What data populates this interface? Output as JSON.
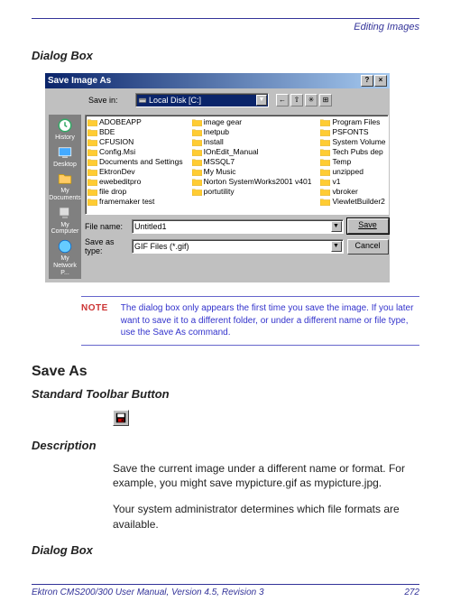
{
  "header": "Editing Images",
  "sections": {
    "dialog_box_1": "Dialog Box",
    "save_as": "Save As",
    "standard_toolbar": "Standard Toolbar Button",
    "description_label": "Description",
    "dialog_box_2": "Dialog Box"
  },
  "dialog": {
    "title": "Save Image As",
    "save_in_label": "Save in:",
    "save_in_value": "Local Disk [C:]",
    "places": [
      {
        "label": "History"
      },
      {
        "label": "Desktop"
      },
      {
        "label": "My Documents"
      },
      {
        "label": "My Computer"
      },
      {
        "label": "My Network P..."
      }
    ],
    "files_col1": [
      "ADOBEAPP",
      "BDE",
      "CFUSION",
      "Config.Msi",
      "Documents and Settings",
      "EktronDev",
      "ewebeditpro",
      "file drop",
      "framemaker test"
    ],
    "files_col2": [
      "image gear",
      "Inetpub",
      "Install",
      "IOnEdit_Manual",
      "MSSQL7",
      "My Music",
      "Norton SystemWorks2001 v401",
      "portutility"
    ],
    "files_col3": [
      "Program Files",
      "PSFONTS",
      "System Volume",
      "Tech Pubs dep",
      "Temp",
      "unzipped",
      "v1",
      "vbroker",
      "ViewletBuilder2"
    ],
    "file_name_label": "File name:",
    "file_name_value": "Untitled1",
    "save_as_type_label": "Save as type:",
    "save_as_type_value": "GIF Files (*.gif)",
    "save_button": "Save",
    "cancel_button": "Cancel"
  },
  "note": {
    "label": "NOTE",
    "text": "The dialog box only appears the first time you save the image. If you later want to save it to a different folder, or under a different name or file type, use the Save As command."
  },
  "description": {
    "p1": "Save the current image under a different name or format. For example, you might save mypicture.gif as mypicture.jpg.",
    "p2": "Your system administrator determines which file formats are available."
  },
  "footer": {
    "left": "Ektron CMS200/300 User Manual, Version 4.5, Revision 3",
    "right": "272"
  }
}
